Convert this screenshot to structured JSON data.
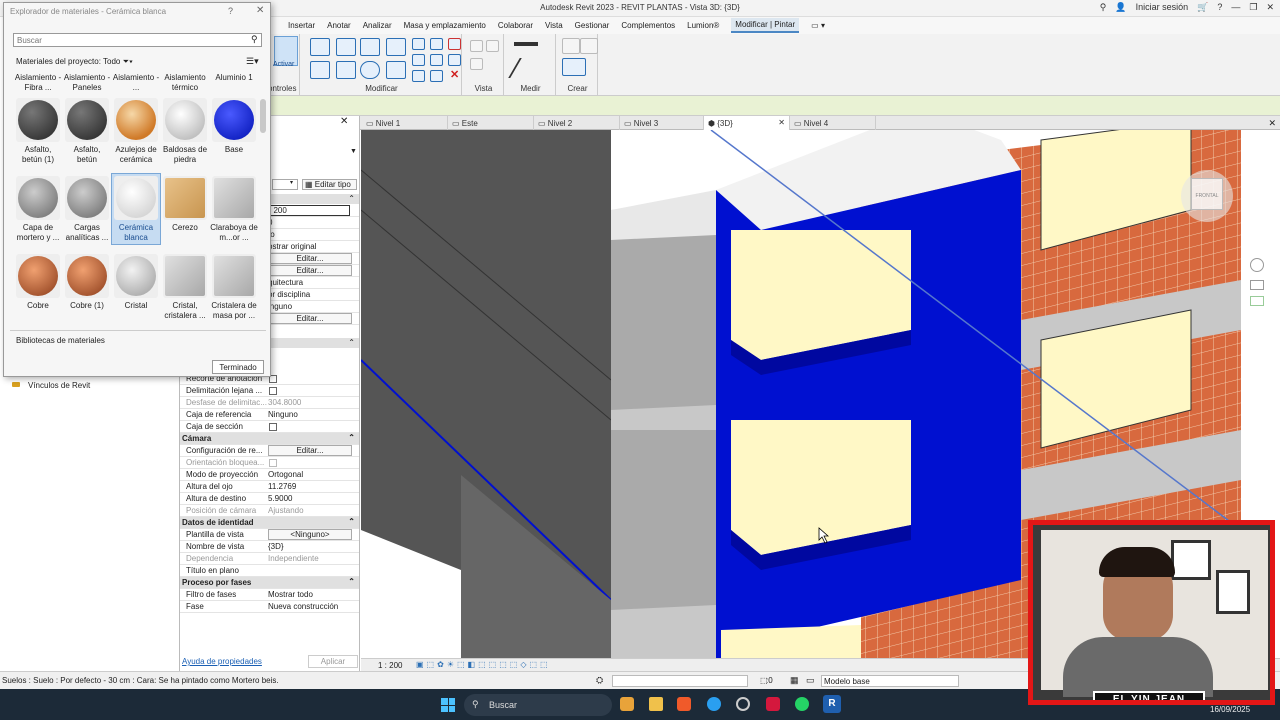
{
  "window": {
    "title": "Autodesk Revit 2023 - REVIT PLANTAS - Vista 3D: {3D}",
    "signin": "Iniciar sesión"
  },
  "menu": [
    "Insertar",
    "Anotar",
    "Analizar",
    "Masa y emplazamiento",
    "Colaborar",
    "Vista",
    "Gestionar",
    "Complementos",
    "Lumion®",
    "Modificar | Pintar"
  ],
  "ribbon": {
    "activar": "Activar",
    "controles": "ontroles",
    "modificar": "Modificar",
    "vista": "Vista",
    "medir": "Medir",
    "crear": "Crear"
  },
  "view_tabs": [
    "Nivel 1",
    "Este",
    "Nivel 2",
    "Nivel 3",
    "{3D}",
    "Nivel 4"
  ],
  "material_dialog": {
    "title": "Explorador de materiales - Cerámica blanca",
    "search_placeholder": "Buscar",
    "filter_label": "Materiales del proyecto: Todo",
    "top_row": [
      "Aislamiento - Fibra ...",
      "Aislamiento - Paneles",
      "Aislamiento - ...",
      "Aislamiento térmico",
      "Aluminio 1"
    ],
    "rows": [
      [
        {
          "label": "Asfalto, betún (1)",
          "kind": "asphalt"
        },
        {
          "label": "Asfalto, betún",
          "kind": "asphalt"
        },
        {
          "label": "Azulejos de cerámica",
          "kind": "tile"
        },
        {
          "label": "Baldosas de piedra",
          "kind": "white"
        },
        {
          "label": "Base",
          "kind": "blue"
        }
      ],
      [
        {
          "label": "Capa de mortero y ...",
          "kind": "grey"
        },
        {
          "label": "Cargas analíticas ...",
          "kind": "grey"
        },
        {
          "label": "Cerámica blanca",
          "kind": "whitesel"
        },
        {
          "label": "Cerezo",
          "kind": "wood"
        },
        {
          "label": "Claraboya de m...or ...",
          "kind": "glass"
        }
      ],
      [
        {
          "label": "Cobre",
          "kind": "copper"
        },
        {
          "label": "Cobre (1)",
          "kind": "copper"
        },
        {
          "label": "Cristal",
          "kind": "crystal"
        },
        {
          "label": "Cristal, cristalera ...",
          "kind": "glass"
        },
        {
          "label": "Cristalera de masa por ...",
          "kind": "glass"
        }
      ]
    ],
    "libraries": "Bibliotecas de materiales",
    "done_button": "Terminado"
  },
  "properties": {
    "edit_type": "Editar tipo",
    "partial_rows": [
      ": 200",
      "0",
      "to",
      "ostrar original",
      "",
      "",
      "quitectura",
      "or disciplina",
      "inguno",
      ""
    ],
    "rows": [
      {
        "k": "Recorte de anotación",
        "v": "",
        "kind": "check"
      },
      {
        "k": "Delimitación lejana ...",
        "v": "",
        "kind": "check"
      },
      {
        "k": "Desfase de delimitac...",
        "v": "304.8000",
        "kind": "grey"
      },
      {
        "k": "Caja de referencia",
        "v": "Ninguno",
        "kind": "text"
      },
      {
        "k": "Caja de sección",
        "v": "",
        "kind": "check"
      },
      {
        "k": "Cámara",
        "v": "",
        "kind": "section"
      },
      {
        "k": "Configuración de re...",
        "v": "Editar...",
        "kind": "button"
      },
      {
        "k": "Orientación bloquea...",
        "v": "",
        "kind": "greycheck"
      },
      {
        "k": "Modo de proyección",
        "v": "Ortogonal",
        "kind": "text"
      },
      {
        "k": "Altura del ojo",
        "v": "11.2769",
        "kind": "text"
      },
      {
        "k": "Altura de destino",
        "v": "5.9000",
        "kind": "text"
      },
      {
        "k": "Posición de cámara",
        "v": "Ajustando",
        "kind": "grey"
      },
      {
        "k": "Datos de identidad",
        "v": "",
        "kind": "section"
      },
      {
        "k": "Plantilla de vista",
        "v": "<Ninguno>",
        "kind": "button"
      },
      {
        "k": "Nombre de vista",
        "v": "{3D}",
        "kind": "text"
      },
      {
        "k": "Dependencia",
        "v": "Independiente",
        "kind": "grey"
      },
      {
        "k": "Título en plano",
        "v": "",
        "kind": "text"
      },
      {
        "k": "Proceso por fases",
        "v": "",
        "kind": "section"
      },
      {
        "k": "Filtro de fases",
        "v": "Mostrar todo",
        "kind": "text"
      },
      {
        "k": "Fase",
        "v": "Nueva construcción",
        "kind": "text"
      }
    ],
    "help_link": "Ayuda de propiedades",
    "apply": "Aplicar",
    "edit": "Editar..."
  },
  "project_browser": {
    "links": "Vínculos de Revit"
  },
  "viewcube": {
    "face": "FRONTAL"
  },
  "viewbar": {
    "scale": "1 : 200"
  },
  "status": {
    "text": "Suelos : Suelo : Por defecto - 30 cm : Cara: Se ha pintado como Mortero beis.",
    "zero": ":0",
    "model": "Modelo base"
  },
  "taskbar": {
    "search": "Buscar",
    "date": "16/09/2025"
  },
  "webcam": {
    "caption": "EL YIN JEAN"
  },
  "colors": {
    "blue": "#0010d0",
    "brick": "#d8693e",
    "cream": "#fff8c6",
    "slab": "#c8c8c8",
    "wall": "#555555"
  }
}
